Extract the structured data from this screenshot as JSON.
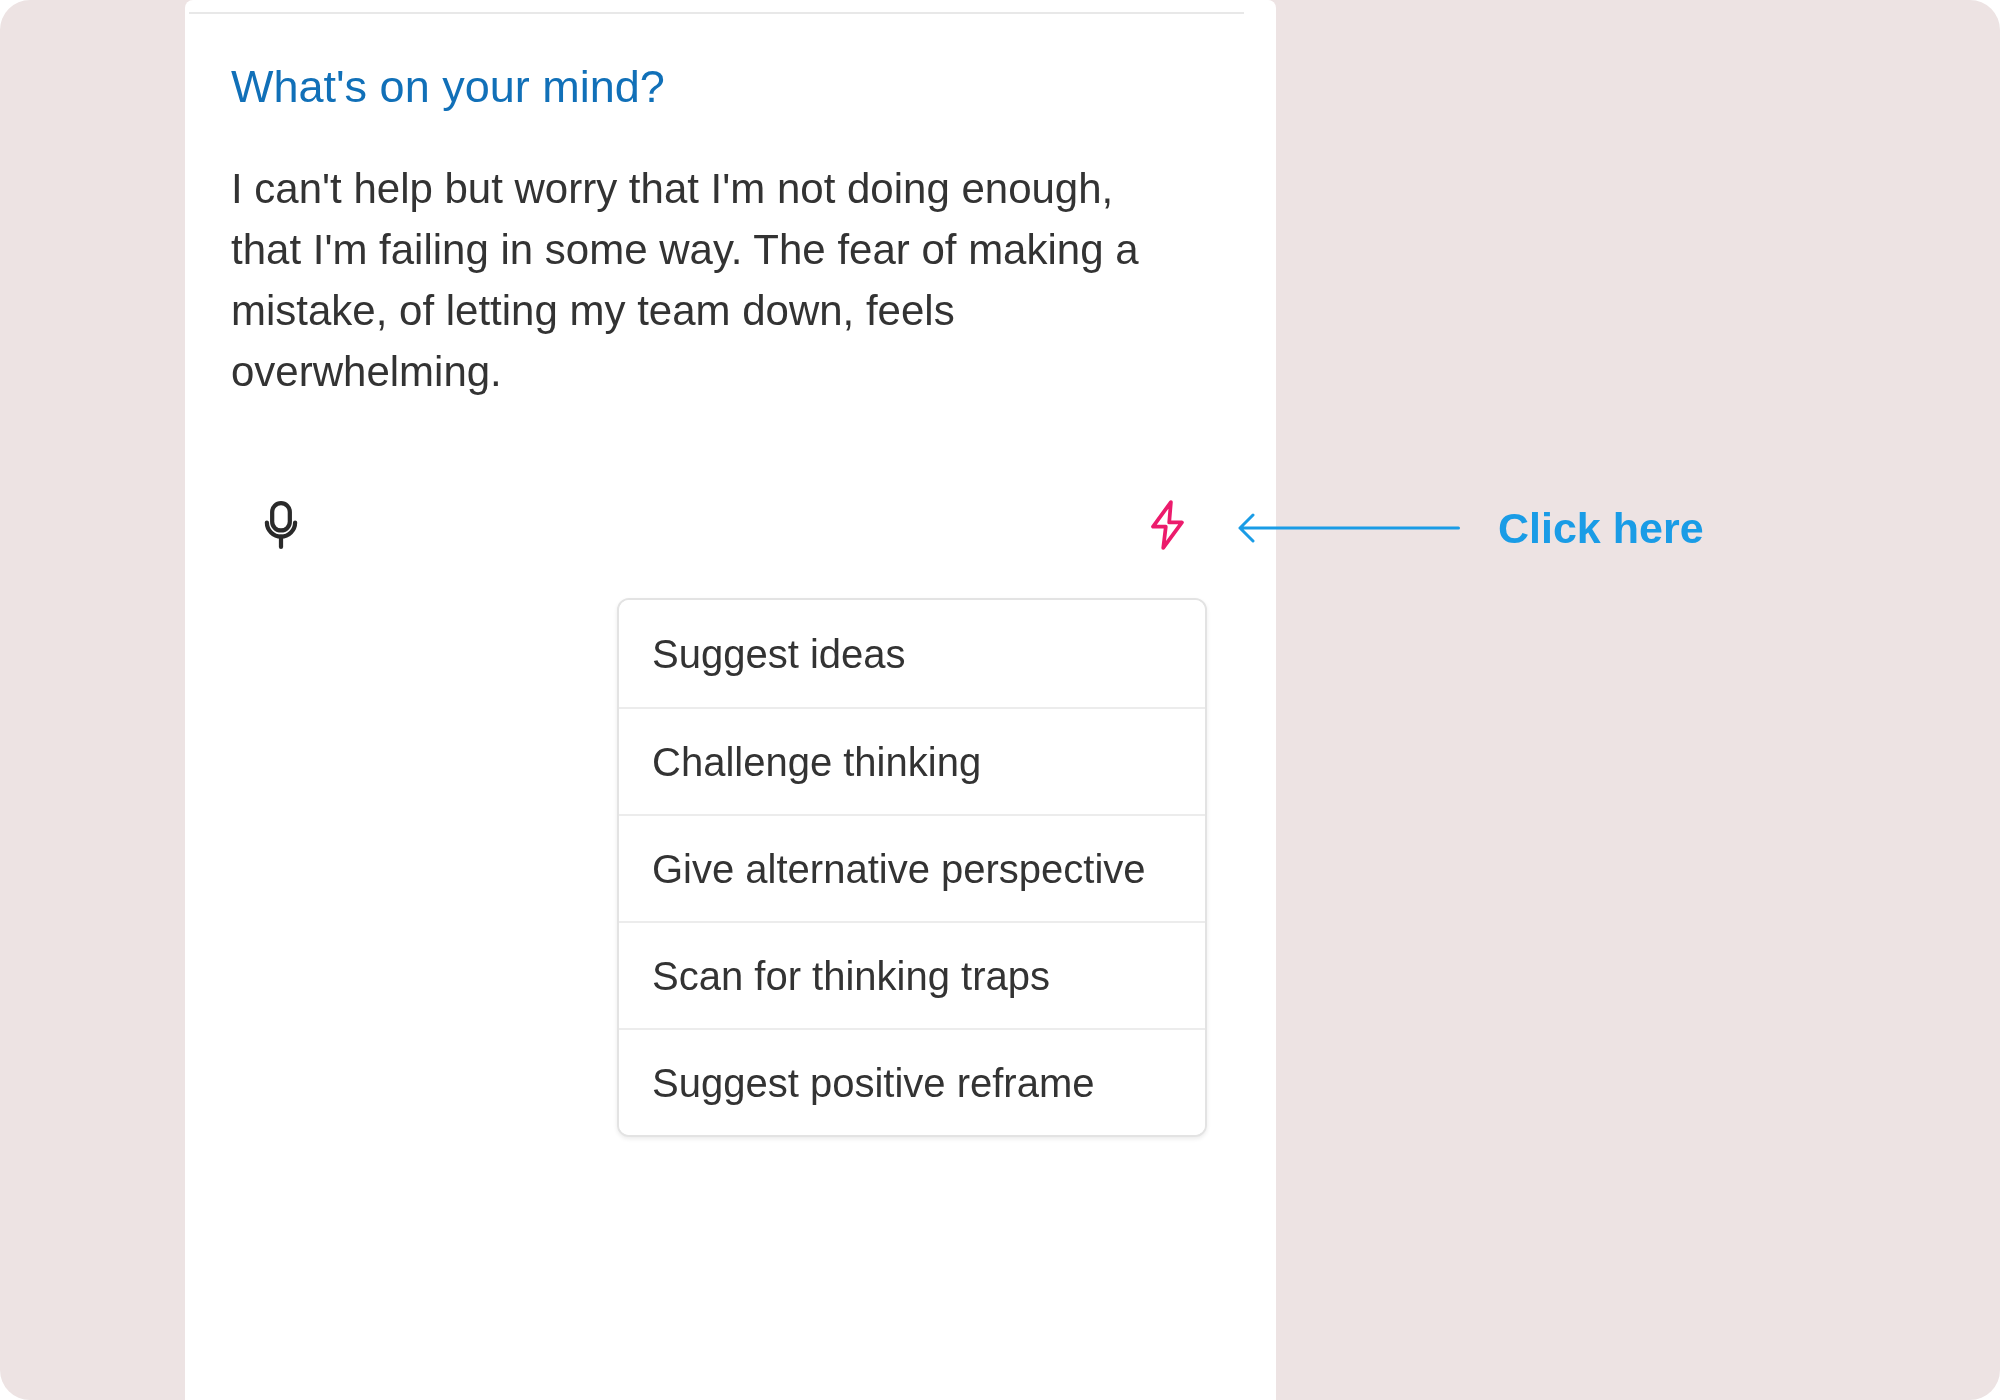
{
  "prompt": {
    "label": "What's on your mind?",
    "entry": {
      "value": "I can't help but worry that I'm not doing enough, that I'm failing in some way. The fear of making a mistake, of letting my team down, feels overwhelming."
    }
  },
  "suggestion_menu": {
    "items": [
      {
        "label": "Suggest ideas"
      },
      {
        "label": "Challenge thinking"
      },
      {
        "label": "Give alternative perspective"
      },
      {
        "label": "Scan for thinking traps"
      },
      {
        "label": "Suggest positive reframe"
      }
    ]
  },
  "callout": {
    "text": "Click here"
  }
}
